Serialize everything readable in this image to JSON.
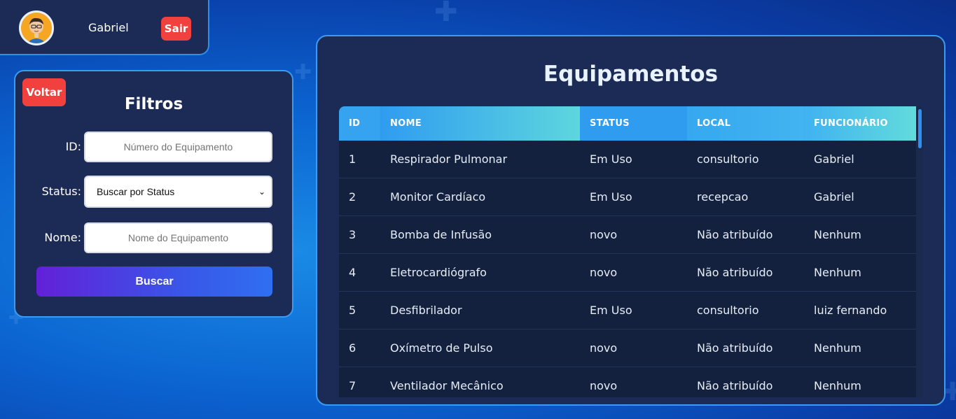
{
  "user": {
    "name": "Gabriel",
    "logout_label": "Sair",
    "avatar_icon": "user-avatar-icon"
  },
  "filters": {
    "back_label": "Voltar",
    "title": "Filtros",
    "id_label": "ID:",
    "id_placeholder": "Número do Equipamento",
    "status_label": "Status:",
    "status_selected": "Buscar por Status",
    "name_label": "Nome:",
    "name_placeholder": "Nome do Equipamento",
    "search_label": "Buscar"
  },
  "equipment": {
    "title": "Equipamentos",
    "columns": [
      "ID",
      "NOME",
      "STATUS",
      "LOCAL",
      "FUNCIONÁRIO"
    ],
    "rows": [
      {
        "id": "1",
        "nome": "Respirador Pulmonar",
        "status": "Em Uso",
        "local": "consultorio",
        "funcionario": "Gabriel"
      },
      {
        "id": "2",
        "nome": "Monitor Cardíaco",
        "status": "Em Uso",
        "local": "recepcao",
        "funcionario": "Gabriel"
      },
      {
        "id": "3",
        "nome": "Bomba de Infusão",
        "status": "novo",
        "local": "Não atribuído",
        "funcionario": "Nenhum"
      },
      {
        "id": "4",
        "nome": "Eletrocardiógrafo",
        "status": "novo",
        "local": "Não atribuído",
        "funcionario": "Nenhum"
      },
      {
        "id": "5",
        "nome": "Desfibrilador",
        "status": "Em Uso",
        "local": "consultorio",
        "funcionario": "luiz fernando"
      },
      {
        "id": "6",
        "nome": "Oxímetro de Pulso",
        "status": "novo",
        "local": "Não atribuído",
        "funcionario": "Nenhum"
      },
      {
        "id": "7",
        "nome": "Ventilador Mecânico",
        "status": "novo",
        "local": "Não atribuído",
        "funcionario": "Nenhum"
      }
    ]
  },
  "colors": {
    "panel_bg": "#1c2b55",
    "panel_border": "#3a9bf0",
    "danger_button": "#f0413e",
    "header_gradient_start": "#2f9cf0",
    "header_gradient_end": "#5ed6de"
  }
}
